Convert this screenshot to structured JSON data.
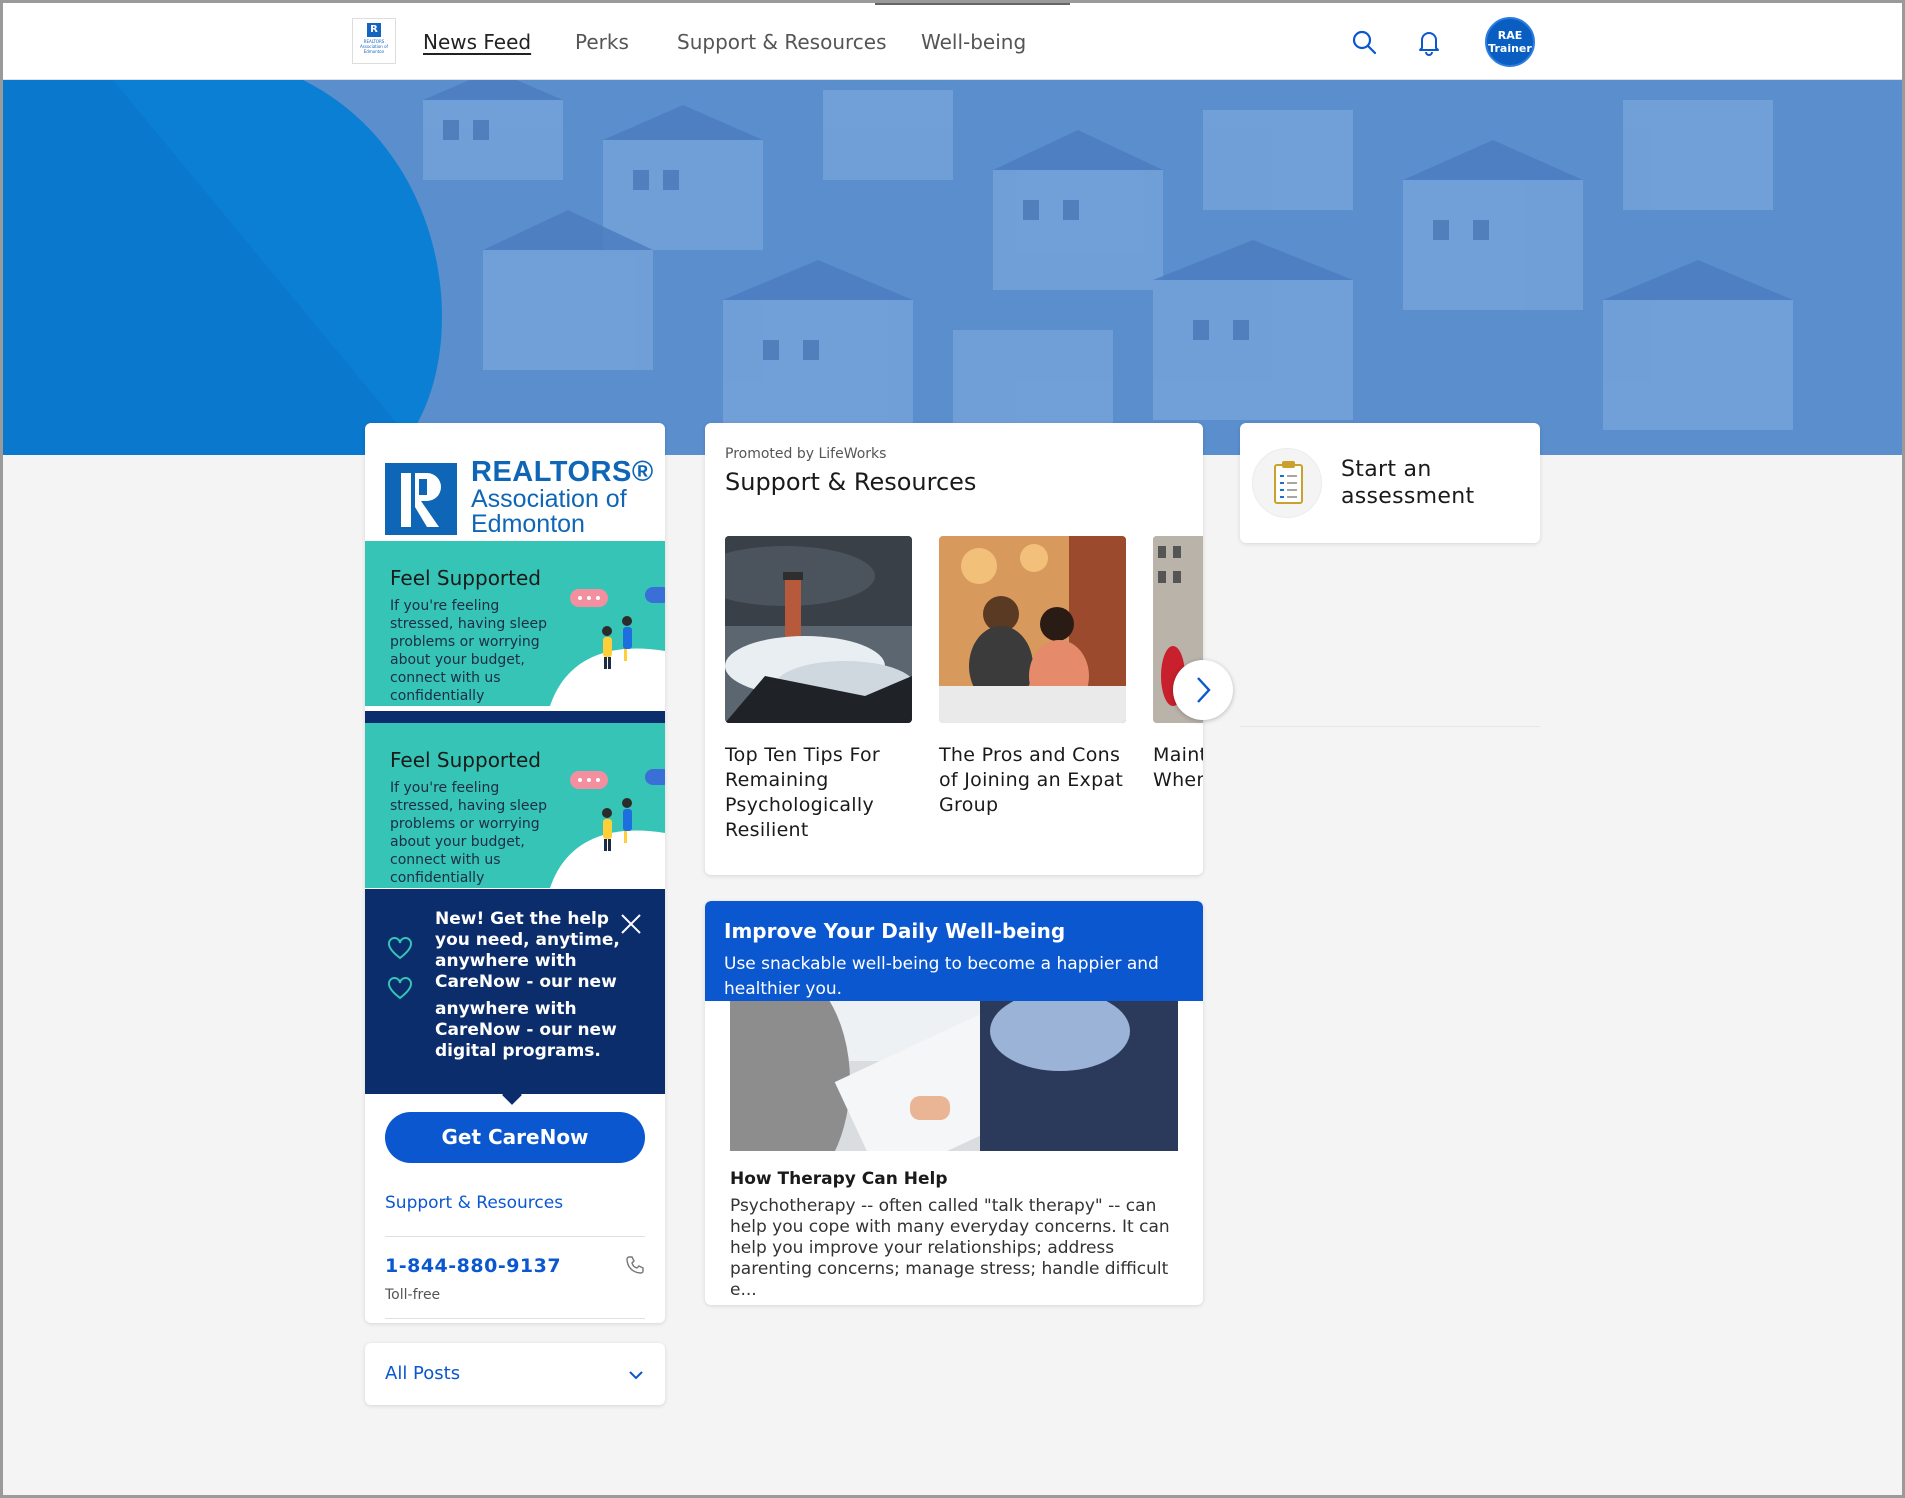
{
  "nav": {
    "logo_text": "REALTORS Association of Edmonton",
    "items": [
      {
        "label": "News Feed",
        "active": true
      },
      {
        "label": "Perks",
        "active": false
      },
      {
        "label": "Support & Resources",
        "active": false
      },
      {
        "label": "Well-being",
        "active": false
      }
    ],
    "avatar": {
      "line1": "RAE",
      "line2": "Trainer"
    }
  },
  "sidebar": {
    "logo": {
      "line1": "REALTORS®",
      "line2": "Association of",
      "line3": "Edmonton"
    },
    "banners": [
      {
        "title": "Feel Supported",
        "body": "If you're feeling stressed, having sleep problems or worrying about your budget, connect with us confidentially"
      },
      {
        "title": "Feel Supported",
        "body": "If you're feeling stressed, having sleep problems or worrying about your budget, connect with us confidentially"
      }
    ],
    "tooltip": {
      "message": "New! Get the help you need, anytime, anywhere with CareNow - our new digital",
      "message_repeat": "anywhere with CareNow - our new digital programs."
    },
    "cta_label": "Get CareNow",
    "support_link": "Support & Resources",
    "phone": "1-844-880-9137",
    "phone_note": "Toll-free"
  },
  "filter": {
    "label": "All Posts"
  },
  "support": {
    "promoted": "Promoted by LifeWorks",
    "title": "Support & Resources",
    "articles": [
      {
        "title": "Top Ten Tips For Remaining Psychologically Resilient"
      },
      {
        "title": "The Pros and Cons of Joining an Expat Group"
      },
      {
        "title": "Maintaining Health When"
      }
    ]
  },
  "wellbeing": {
    "title": "Improve Your Daily Well-being",
    "subtitle": "Use snackable well-being to become a happier and healthier you.",
    "article_title": "How Therapy Can Help",
    "article_body": "Psychotherapy -- often called \"talk therapy\" -- can help you cope with many everyday concerns. It can help you improve your relationships; address parenting concerns; manage stress; handle difficult e..."
  },
  "assessment": {
    "label": "Start an assessment"
  },
  "colors": {
    "primary": "#0b57d0",
    "navy": "#0b2d6b",
    "teal": "#35c4b5",
    "brand": "#0f66b7",
    "hero": "#5a8ecf"
  }
}
